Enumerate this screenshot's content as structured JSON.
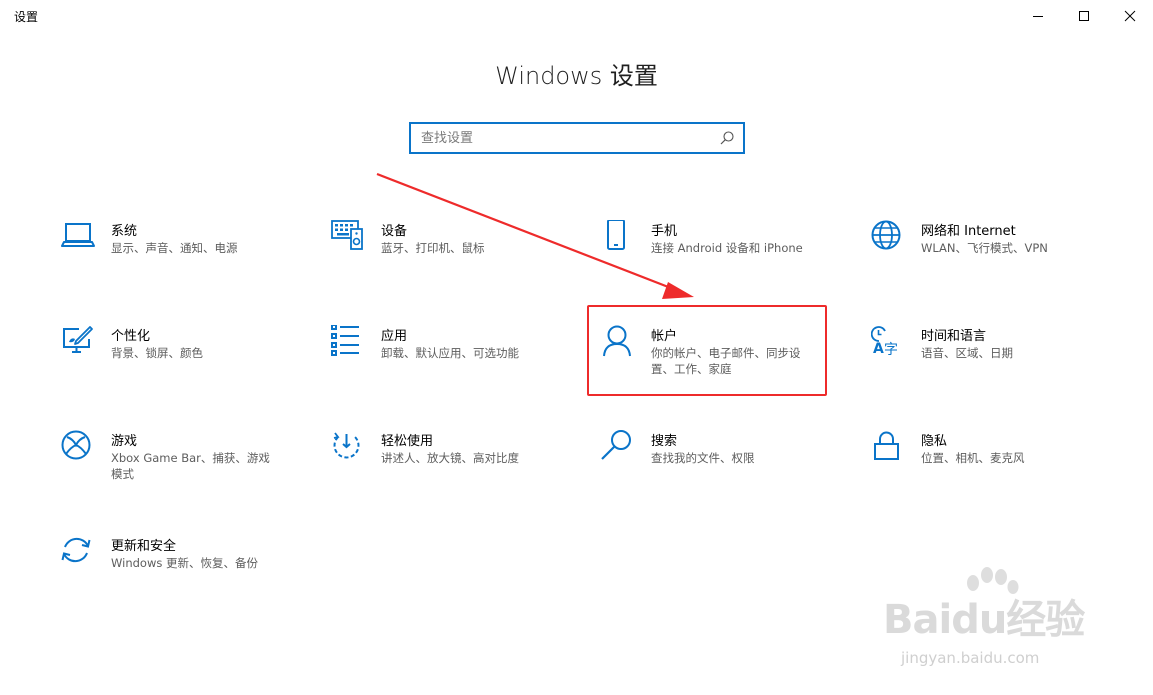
{
  "window": {
    "title": "设置"
  },
  "page_title": "Windows 设置",
  "search": {
    "placeholder": "查找设置",
    "value": ""
  },
  "tiles": [
    {
      "name": "系统",
      "desc": "显示、声音、通知、电源",
      "icon": "laptop-icon"
    },
    {
      "name": "设备",
      "desc": "蓝牙、打印机、鼠标",
      "icon": "devices-icon"
    },
    {
      "name": "手机",
      "desc": "连接 Android 设备和 iPhone",
      "icon": "phone-icon"
    },
    {
      "name": "网络和 Internet",
      "desc": "WLAN、飞行模式、VPN",
      "icon": "globe-icon"
    },
    {
      "name": "个性化",
      "desc": "背景、锁屏、颜色",
      "icon": "personalize-icon"
    },
    {
      "name": "应用",
      "desc": "卸载、默认应用、可选功能",
      "icon": "apps-list-icon"
    },
    {
      "name": "帐户",
      "desc": "你的帐户、电子邮件、同步设置、工作、家庭",
      "icon": "person-icon"
    },
    {
      "name": "时间和语言",
      "desc": "语音、区域、日期",
      "icon": "time-language-icon"
    },
    {
      "name": "游戏",
      "desc": "Xbox Game Bar、捕获、游戏模式",
      "icon": "xbox-icon"
    },
    {
      "name": "轻松使用",
      "desc": "讲述人、放大镜、高对比度",
      "icon": "ease-of-access-icon"
    },
    {
      "name": "搜索",
      "desc": "查找我的文件、权限",
      "icon": "search-magnifier-icon"
    },
    {
      "name": "隐私",
      "desc": "位置、相机、麦克风",
      "icon": "lock-icon"
    },
    {
      "name": "更新和安全",
      "desc": "Windows 更新、恢复、备份",
      "icon": "sync-icon"
    }
  ],
  "watermark": {
    "brand": "Baidu经验",
    "url": "jingyan.baidu.com"
  },
  "colors": {
    "accent": "#0a74c9",
    "highlight": "#ee2b2b",
    "text": "#000000",
    "secondary_text": "#5d5d5d"
  }
}
